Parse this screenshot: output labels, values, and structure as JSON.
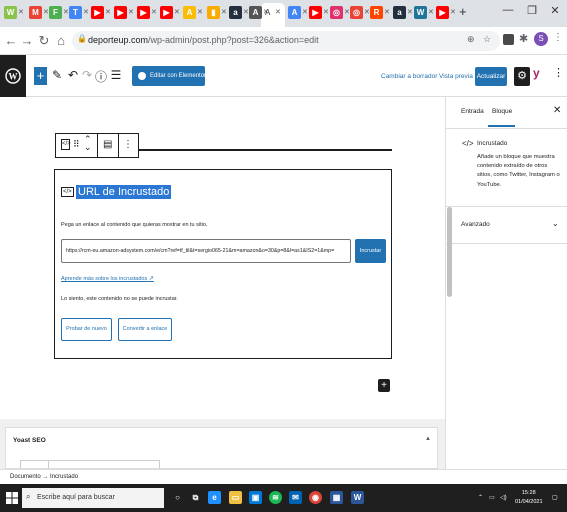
{
  "browser": {
    "url_host": "deporteup.com",
    "url_path": "/wp-admin/post.php?post=326&action=edit",
    "profile_initial": "S",
    "window_controls": [
      "—",
      "❐",
      "✕"
    ],
    "new_tab": "+"
  },
  "tabs": [
    {
      "icon": "W",
      "color": "#8bc34a"
    },
    {
      "icon": "M",
      "color": "#ea4335"
    },
    {
      "icon": "F",
      "color": "#4caf50"
    },
    {
      "icon": "T",
      "color": "#4285f4"
    },
    {
      "icon": "▶",
      "color": "#ff0000"
    },
    {
      "icon": "▶",
      "color": "#ff0000"
    },
    {
      "icon": "▶",
      "color": "#ff0000"
    },
    {
      "icon": "▶",
      "color": "#ff0000"
    },
    {
      "icon": "A",
      "color": "#fbbc04"
    },
    {
      "icon": "▮",
      "color": "#f9ab00"
    },
    {
      "icon": "a",
      "color": "#232f3e"
    },
    {
      "icon": "A",
      "color": "#555555"
    },
    {
      "icon": "A",
      "color": "#4285f4"
    },
    {
      "icon": "▶",
      "color": "#ff0000"
    },
    {
      "icon": "◎",
      "color": "#e1306c"
    },
    {
      "icon": "◎",
      "color": "#ea4335"
    },
    {
      "icon": "R",
      "color": "#ff4500"
    },
    {
      "icon": "a",
      "color": "#232f3e"
    },
    {
      "icon": "W",
      "color": "#21759b"
    },
    {
      "icon": "▶",
      "color": "#ff0000"
    }
  ],
  "active_tab_label": "A",
  "wp_toolbar": {
    "elementor_label": "Editar con Elementor",
    "draft_label": "Cambiar a borrador",
    "preview_label": "Vista previa",
    "update_label": "Actualizar"
  },
  "embed_block": {
    "title": "URL de Incrustado",
    "description": "Pega un enlace al contenido que quieras mostrar en tu sitio.",
    "input_value": "https://rcm-eu.amazon-adsystem.com/e/cm?ref=tf_til&t=sergio065-21&m=amazon&o=30&p=8&l=as1&IS2=1&mp=",
    "submit_label": "Incrustar",
    "learn_link": "Aprende más sobre los incrustados",
    "error_message": "Lo siento, este contenido no se puede incrustar.",
    "retry_label": "Probar de nuevo",
    "convert_label": "Convertir a enlace"
  },
  "meta_boxes": {
    "yoast_title": "Yoast SEO"
  },
  "sidebar": {
    "tab_post": "Entrada",
    "tab_block": "Bloque",
    "block_name": "Incrustado",
    "block_description": "Añade un bloque que muestra contenido extraído de otros sitios, como Twitter, Instagram o YouTube.",
    "advanced_label": "Avanzado"
  },
  "status": {
    "breadcrumb_root": "Documento",
    "breadcrumb_sep": "→",
    "breadcrumb_current": "Incrustado"
  },
  "taskbar": {
    "search_placeholder": "Escribe aquí para buscar",
    "time": "15:28",
    "date": "01/04/2021"
  }
}
